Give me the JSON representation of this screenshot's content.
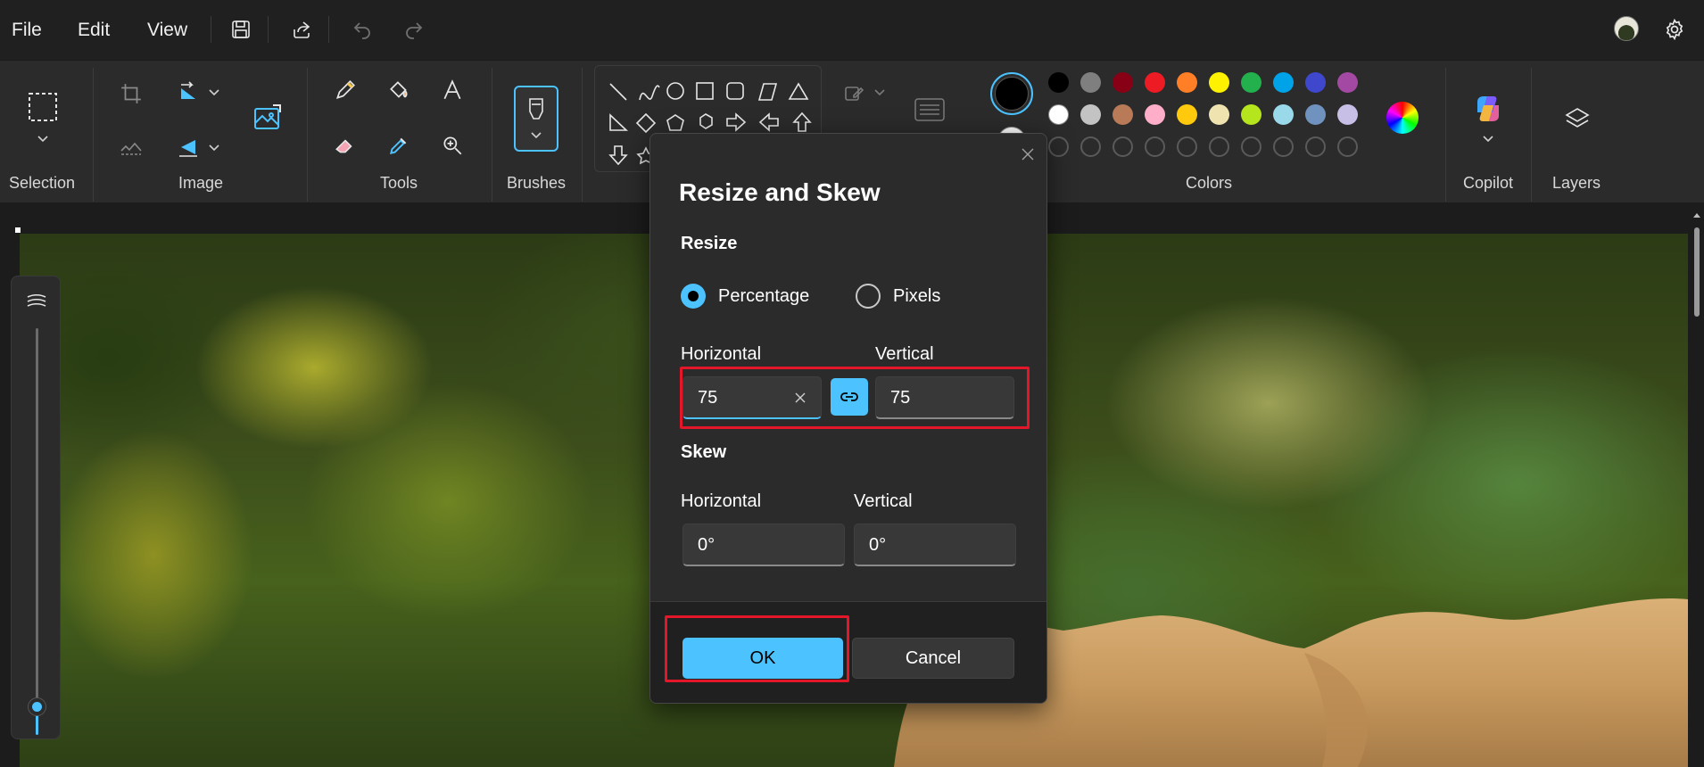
{
  "menu": {
    "file": "File",
    "edit": "Edit",
    "view": "View"
  },
  "quick_access_icons": [
    "save-icon",
    "share-icon",
    "undo-icon",
    "redo-icon"
  ],
  "ribbon": {
    "groups": {
      "selection": "Selection",
      "image": "Image",
      "tools": "Tools",
      "brushes": "Brushes",
      "colors": "Colors",
      "copilot": "Copilot",
      "layers": "Layers"
    }
  },
  "colors": {
    "accent": "#4cc2ff",
    "highlight": "#e3162a",
    "palette_row1": [
      "#000000",
      "#7f7f7f",
      "#880015",
      "#ed1c24",
      "#ff7f27",
      "#fff200",
      "#22b14c",
      "#00a2e8",
      "#3f48cc",
      "#a349a4"
    ],
    "palette_row2": [
      "#ffffff",
      "#c3c3c3",
      "#b97a57",
      "#ffaec9",
      "#ffc90e",
      "#efe4b0",
      "#b5e61d",
      "#99d9ea",
      "#7092be",
      "#c8bfe7"
    ],
    "primary": "#000000",
    "secondary": "#ffffff"
  },
  "dialog": {
    "title": "Resize and Skew",
    "resize": {
      "heading": "Resize",
      "options": [
        "Percentage",
        "Pixels"
      ],
      "selected": "Percentage",
      "horizontal_label": "Horizontal",
      "vertical_label": "Vertical",
      "horizontal_value": "75",
      "vertical_value": "75",
      "aspect_locked": true
    },
    "skew": {
      "heading": "Skew",
      "horizontal_label": "Horizontal",
      "vertical_label": "Vertical",
      "horizontal_value": "0°",
      "vertical_value": "0°"
    },
    "ok_label": "OK",
    "cancel_label": "Cancel"
  }
}
